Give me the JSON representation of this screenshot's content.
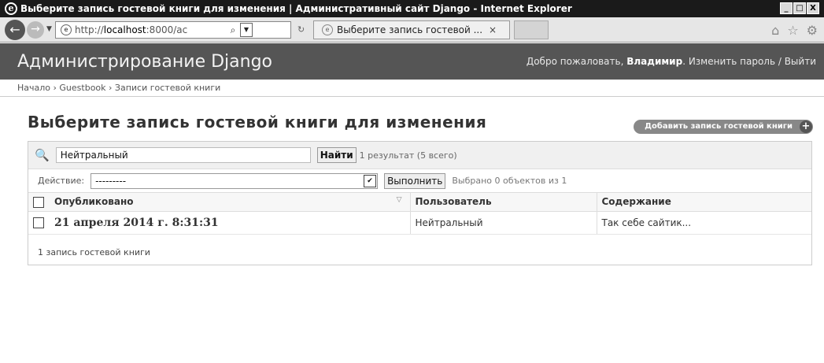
{
  "window": {
    "title": "Выберите запись гостевой книги для изменения | Административный сайт Django - Internet Explorer",
    "minimize": "_",
    "maximize": "□",
    "close": "X"
  },
  "browser": {
    "back_glyph": "←",
    "forward_glyph": "→",
    "dropdown_glyph": "▼",
    "url_prefix": "http://",
    "url_host": "localhost",
    "url_rest": ":8000/ac",
    "search_glyph": "⌕",
    "refresh_glyph": "↻",
    "tab_title": "Выберите запись гостевой ...",
    "tab_close": "×",
    "home_icon": "⌂",
    "favorites_icon": "☆",
    "tools_icon": "⚙"
  },
  "header": {
    "brand": "Администрирование Django",
    "welcome": "Добро пожаловать,",
    "username": "Владимир",
    "user_links": ". Изменить пароль / Выйти"
  },
  "breadcrumbs": "Начало › Guestbook › Записи гостевой книги",
  "main": {
    "title": "Выберите запись гостевой книги для изменения",
    "add_button": "Добавить запись гостевой книги",
    "add_plus": "+"
  },
  "search": {
    "icon": "🔍",
    "value": "Нейтральный",
    "button": "Найти",
    "result_count": "1 результат (5 всего)"
  },
  "actions": {
    "label": "Действие:",
    "selected": "---------",
    "button": "Выполнить",
    "counter": "Выбрано 0 объектов из 1"
  },
  "table": {
    "columns": [
      "Опубликовано",
      "Пользователь",
      "Содержание"
    ],
    "sort_glyph": "▽",
    "rows": [
      {
        "published": "21 апреля 2014 г. 8:31:31",
        "user": "Нейтральный",
        "content": "Так себе сайтик..."
      }
    ]
  },
  "paginator": "1 запись гостевой книги"
}
